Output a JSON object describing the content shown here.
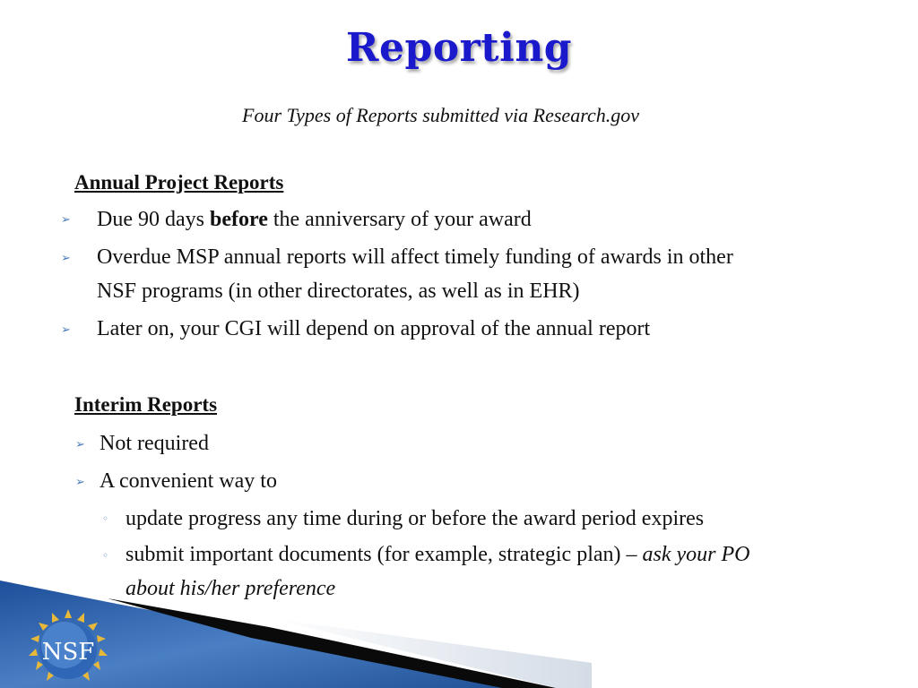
{
  "slide": {
    "title": "Reporting",
    "subtitle": "Four Types of Reports submitted via Research.gov",
    "sections": [
      {
        "heading": "Annual Project Reports",
        "bullets": [
          {
            "pre": "Due 90 days ",
            "bold": "before",
            "post": " the anniversary of your award"
          },
          {
            "line1": "Overdue MSP annual reports will affect timely funding of awards in other",
            "line2": "NSF programs (in other directorates, as well as in EHR)"
          },
          {
            "text": "Later on, your CGI will depend on approval of the annual report"
          }
        ]
      },
      {
        "heading": "Interim Reports",
        "bullets": [
          {
            "text": "Not required"
          },
          {
            "text": "A convenient way to"
          }
        ],
        "subbullets": [
          {
            "text": "update progress any time during or before the award period expires"
          },
          {
            "pre": "submit important documents (for example, strategic plan) – ",
            "italic": "ask your PO",
            "line2": "about his/her preference"
          }
        ]
      }
    ],
    "logo": {
      "text": "NSF",
      "icon": "nsf-logo-icon"
    },
    "bullet_glyph": "➢",
    "subbullet_glyph": "◦",
    "colors": {
      "title": "#1a1acc",
      "bullet": "#4a7ebb",
      "band": "#2a5ea8"
    }
  }
}
